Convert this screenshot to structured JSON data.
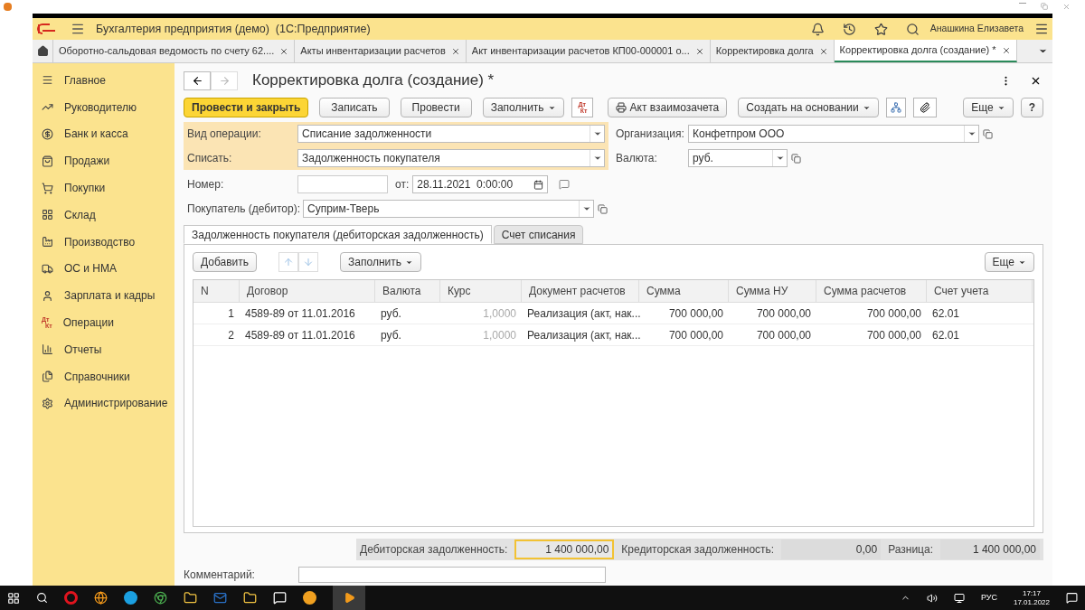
{
  "app_header": {
    "title": "Бухгалтерия предприятия (демо)  (1С:Предприятие)",
    "user": "Анашкина Елизавета"
  },
  "open_tabs": [
    {
      "label": "Оборотно-сальдовая ведомость по счету 62....",
      "selected": false
    },
    {
      "label": "Акты инвентаризации расчетов",
      "selected": false
    },
    {
      "label": "Акт инвентаризации расчетов КП00-000001 о...",
      "selected": false
    },
    {
      "label": "Корректировка долга",
      "selected": false
    },
    {
      "label": "Корректировка долга (создание) *",
      "selected": true
    }
  ],
  "sidebar": {
    "items": [
      {
        "label": "Главное"
      },
      {
        "label": "Руководителю"
      },
      {
        "label": "Банк и касса"
      },
      {
        "label": "Продажи"
      },
      {
        "label": "Покупки"
      },
      {
        "label": "Склад"
      },
      {
        "label": "Производство"
      },
      {
        "label": "ОС и НМА"
      },
      {
        "label": "Зарплата и кадры"
      },
      {
        "label": "Операции"
      },
      {
        "label": "Отчеты"
      },
      {
        "label": "Справочники"
      },
      {
        "label": "Администрирование"
      }
    ],
    "dtkt": [
      "Дт",
      "Кт"
    ]
  },
  "form": {
    "title": "Корректировка долга (создание) *",
    "toolbar": {
      "primary": "Провести и закрыть",
      "buttons": [
        "Записать",
        "Провести"
      ],
      "fill": "Заполнить",
      "dtkt": [
        "Дт",
        "Кт"
      ],
      "print": "Акт взаимозачета",
      "create_based": "Создать на основании",
      "more": "Еще",
      "help": "?"
    },
    "fields": {
      "operation_label": "Вид операции:",
      "operation": "Списание задолженности",
      "writeoff_label": "Списать:",
      "writeoff": "Задолженность покупателя",
      "org_label": "Организация:",
      "org": "Конфетпром ООО",
      "currency_label": "Валюта:",
      "currency": "руб.",
      "number_label": "Номер:",
      "date_label": "от:",
      "date": "28.11.2021  0:00:00",
      "buyer_label": "Покупатель (дебитор):",
      "buyer": "Суприм-Тверь"
    },
    "tabs": [
      {
        "label": "Задолженность покупателя (дебиторская задолженность)",
        "selected": true
      },
      {
        "label": "Счет списания",
        "selected": false
      }
    ],
    "table_toolbar": {
      "add": "Добавить",
      "fill": "Заполнить",
      "more": "Еще"
    },
    "table": {
      "columns": [
        "N",
        "Договор",
        "Валюта",
        "Курс",
        "Документ расчетов",
        "Сумма",
        "Сумма НУ",
        "Сумма расчетов",
        "Счет учета"
      ],
      "rows": [
        [
          "1",
          "4589-89 от 11.01.2016",
          "руб.",
          "1,0000",
          "Реализация (акт, нак...",
          "700 000,00",
          "700 000,00",
          "700 000,00",
          "62.01"
        ],
        [
          "2",
          "4589-89 от 11.01.2016",
          "руб.",
          "1,0000",
          "Реализация (акт, нак...",
          "700 000,00",
          "700 000,00",
          "700 000,00",
          "62.01"
        ]
      ]
    },
    "totals": [
      {
        "label": "Дебиторская задолженность:",
        "value": "1 400 000,00",
        "focused": true
      },
      {
        "label": "Кредиторская задолженность:",
        "value": "0,00",
        "focused": false
      },
      {
        "label": "Разница:",
        "value": "1 400 000,00",
        "focused": false
      }
    ],
    "comment_label": "Комментарий:"
  },
  "taskbar": {
    "language": "РУС",
    "time": "17:17",
    "date": "17.01.2022"
  }
}
